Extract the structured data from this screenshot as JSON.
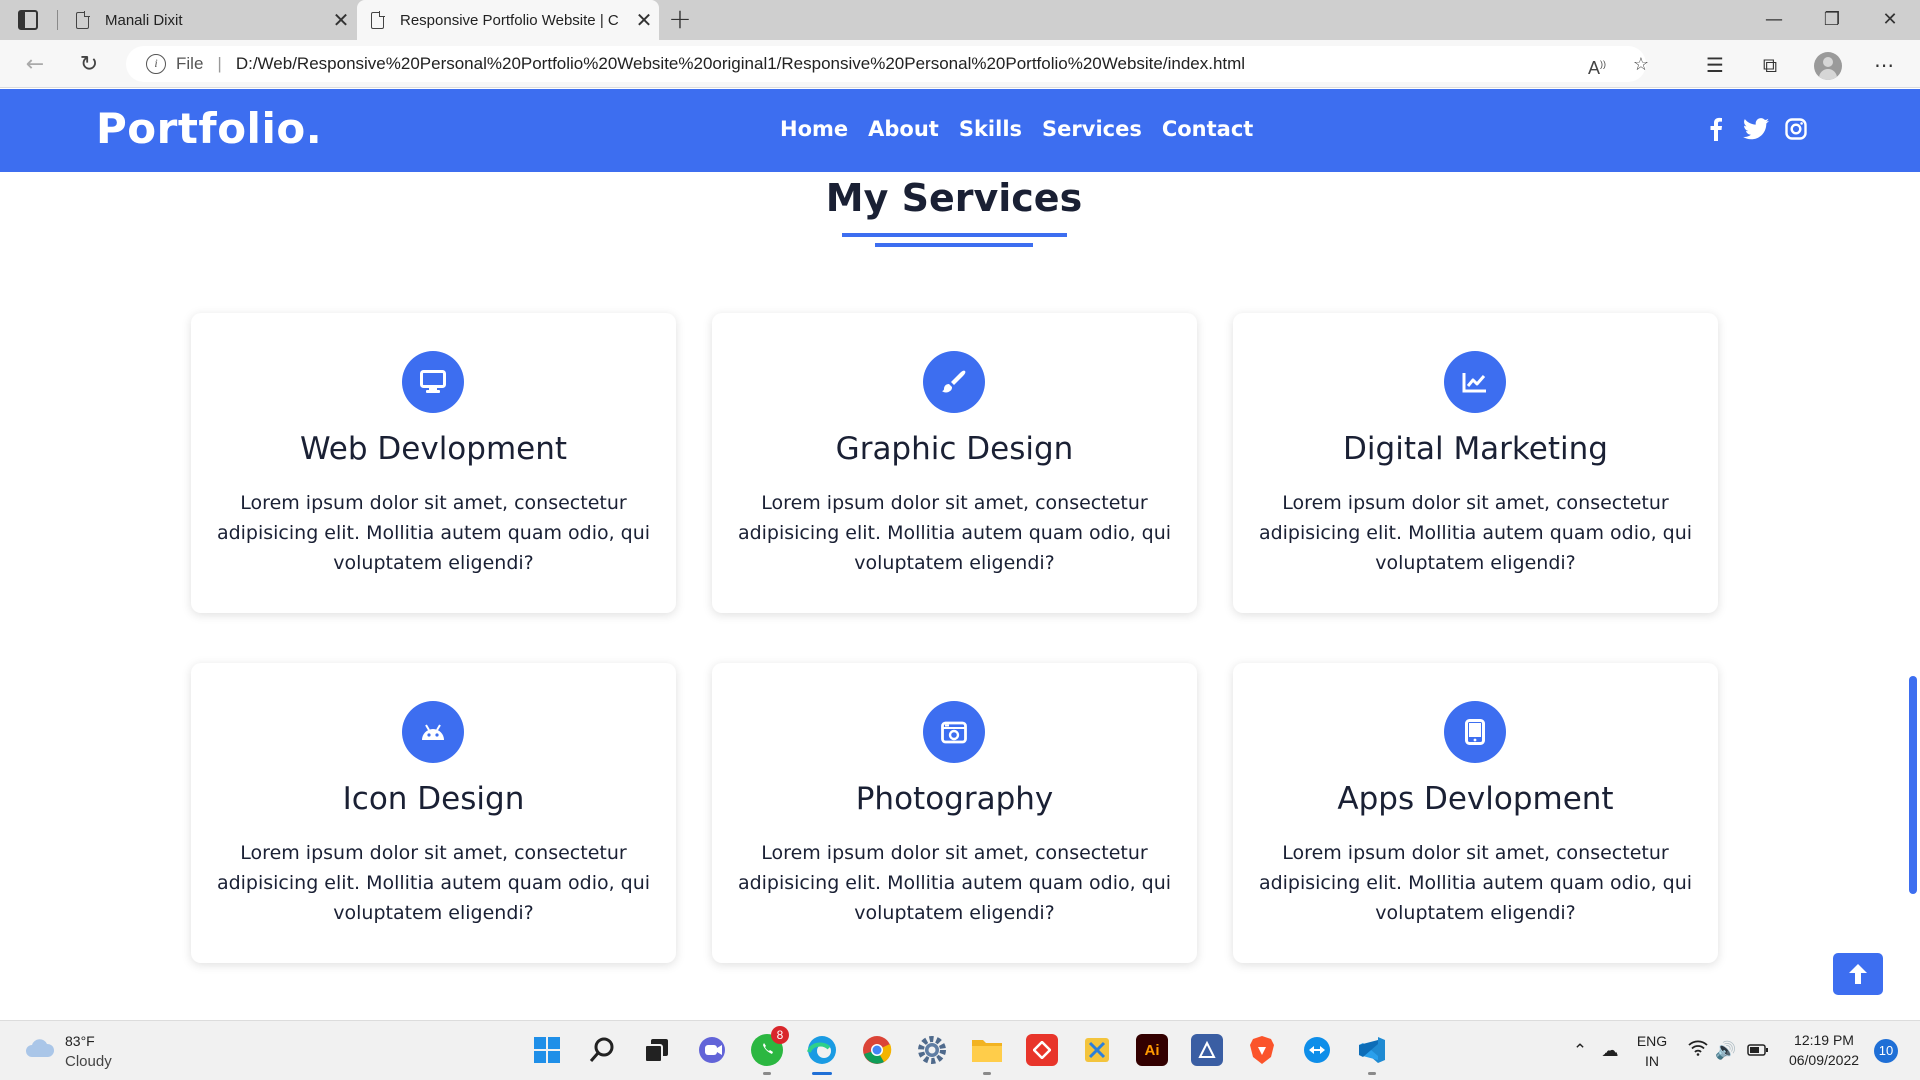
{
  "browser": {
    "tabs": [
      {
        "title": "Manali Dixit",
        "active": false
      },
      {
        "title": "Responsive Portfolio Website | C",
        "active": true
      }
    ],
    "url_scheme": "File",
    "url": "D:/Web/Responsive%20Personal%20Portfolio%20Website%20original1/Responsive%20Personal%20Portfolio%20Website/index.html"
  },
  "site": {
    "brand": "Portfolio.",
    "menu": [
      "Home",
      "About",
      "Skills",
      "Services",
      "Contact"
    ],
    "social_icons": [
      "facebook-icon",
      "twitter-icon",
      "instagram-icon"
    ],
    "accent_color": "#3d6ef0"
  },
  "services": {
    "title": "My Services",
    "cards": [
      {
        "icon": "desktop-icon",
        "title": "Web Devlopment",
        "text": "Lorem ipsum dolor sit amet, consectetur adipisicing elit. Mollitia autem quam odio, qui voluptatem eligendi?"
      },
      {
        "icon": "paint-brush-icon",
        "title": "Graphic Design",
        "text": "Lorem ipsum dolor sit amet, consectetur adipisicing elit. Mollitia autem quam odio, qui voluptatem eligendi?"
      },
      {
        "icon": "chart-line-icon",
        "title": "Digital Marketing",
        "text": "Lorem ipsum dolor sit amet, consectetur adipisicing elit. Mollitia autem quam odio, qui voluptatem eligendi?"
      },
      {
        "icon": "android-icon",
        "title": "Icon Design",
        "text": "Lorem ipsum dolor sit amet, consectetur adipisicing elit. Mollitia autem quam odio, qui voluptatem eligendi?"
      },
      {
        "icon": "camera-retro-icon",
        "title": "Photography",
        "text": "Lorem ipsum dolor sit amet, consectetur adipisicing elit. Mollitia autem quam odio, qui voluptatem eligendi?"
      },
      {
        "icon": "tablet-icon",
        "title": "Apps Devlopment",
        "text": "Lorem ipsum dolor sit amet, consectetur adipisicing elit. Mollitia autem quam odio, qui voluptatem eligendi?"
      }
    ]
  },
  "taskbar": {
    "weather_temp": "83°F",
    "weather_desc": "Cloudy",
    "whatsapp_badge": "8",
    "ai_label": "Ai",
    "lang_top": "ENG",
    "lang_bottom": "IN",
    "time": "12:19 PM",
    "date": "06/09/2022",
    "notifications": "10"
  }
}
